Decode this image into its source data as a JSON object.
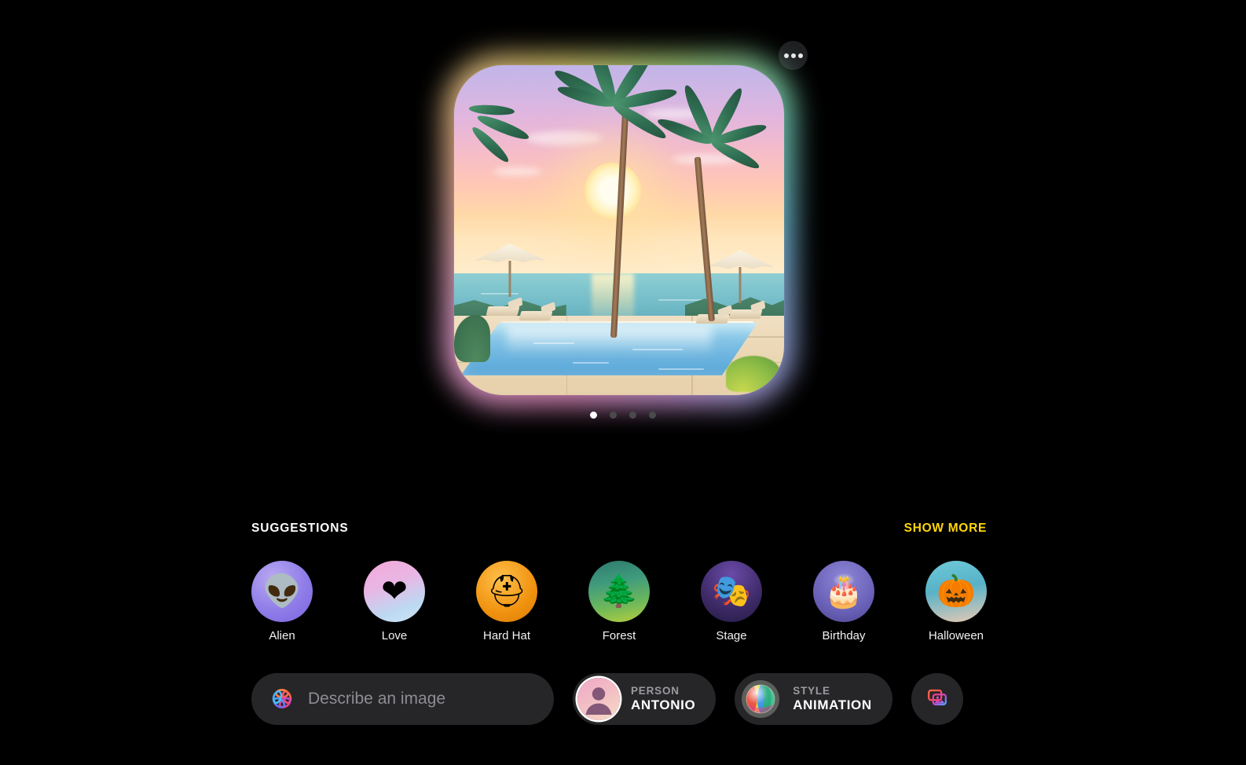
{
  "app": {
    "background": "#000000",
    "accent_yellow": "#ffd60a"
  },
  "header": {
    "more_button_icon": "ellipsis-icon",
    "more_button_label": "More options"
  },
  "preview": {
    "alt": "Illustrated tropical sunset over a swimming pool with palm trees and umbrellas",
    "glow": "rainbow",
    "page_dots": [
      {
        "active": true
      },
      {
        "active": false
      },
      {
        "active": false
      },
      {
        "active": false
      }
    ]
  },
  "suggestions": {
    "title": "SUGGESTIONS",
    "show_more_label": "SHOW MORE",
    "items": [
      {
        "label": "Alien",
        "icon": "alien-icon",
        "glyph": "👽",
        "class": "ic-alien"
      },
      {
        "label": "Love",
        "icon": "heart-icon",
        "glyph": "❤",
        "class": "ic-love"
      },
      {
        "label": "Hard Hat",
        "icon": "hard-hat-icon",
        "glyph": "⛑",
        "class": "ic-hat"
      },
      {
        "label": "Forest",
        "icon": "forest-icon",
        "glyph": "🌲",
        "class": "ic-forest"
      },
      {
        "label": "Stage",
        "icon": "stage-icon",
        "glyph": "🎭",
        "class": "ic-stage"
      },
      {
        "label": "Birthday",
        "icon": "birthday-icon",
        "glyph": "🎂",
        "class": "ic-birth"
      },
      {
        "label": "Halloween",
        "icon": "halloween-icon",
        "glyph": "🎃",
        "class": "ic-hallow"
      }
    ]
  },
  "composer": {
    "prompt_placeholder": "Describe an image",
    "prompt_value": "",
    "prompt_icon": "image-playground-icon",
    "person": {
      "key": "PERSON",
      "value": "ANTONIO",
      "icon": "person-avatar-icon"
    },
    "style": {
      "key": "STYLE",
      "value": "ANIMATION",
      "icon": "style-sphere-icon"
    },
    "library_button": {
      "icon": "photo-library-icon",
      "label": "Photo library"
    }
  }
}
